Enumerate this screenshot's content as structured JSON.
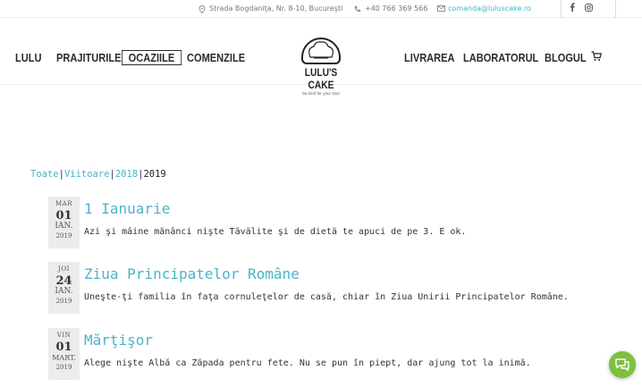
{
  "topbar": {
    "address": "Strada Bogdaniţa, Nr. 8-10, Bucureşti",
    "phone": "+40 766 369 566",
    "email": "comanda@luluscake.ro",
    "social": [
      "facebook-icon",
      "instagram-icon"
    ]
  },
  "nav": {
    "left": [
      "LULU",
      "PRAJITURILE",
      "OCAZIILE",
      "COMENZILE"
    ],
    "right": [
      "LIVRAREA",
      "LABORATORUL",
      "BLOGUL"
    ],
    "active": "OCAZIILE"
  },
  "logo": {
    "name": "LULU'S CAKE",
    "tagline": "be kind for your soul"
  },
  "filters": {
    "items": [
      "Toate",
      "Viitoare",
      "2018",
      "2019"
    ],
    "active": "2019"
  },
  "events": [
    {
      "dow": "MAR",
      "day": "01",
      "month": "IAN.",
      "year": "2019",
      "title": "1 Ianuarie",
      "desc": "Azi şi mâine mănânci nişte Tăvălite şi de dietă te apuci de pe 3. E ok."
    },
    {
      "dow": "JOI",
      "day": "24",
      "month": "IAN.",
      "year": "2019",
      "title": "Ziua Principatelor Române",
      "desc": "Uneşte-ţi familia în faţa cornuleţelor de casă, chiar în Ziua Unirii Principatelor Române."
    },
    {
      "dow": "VIN",
      "day": "01",
      "month": "MART.",
      "year": "2019",
      "title": "Mărţişor",
      "desc": "Alege nişte Albă ca Zăpada pentru fete. Nu se pun în piept, dar ajung tot la inimă."
    }
  ],
  "colors": {
    "accent": "#4bb3c9",
    "chat": "#7fbf3f"
  }
}
